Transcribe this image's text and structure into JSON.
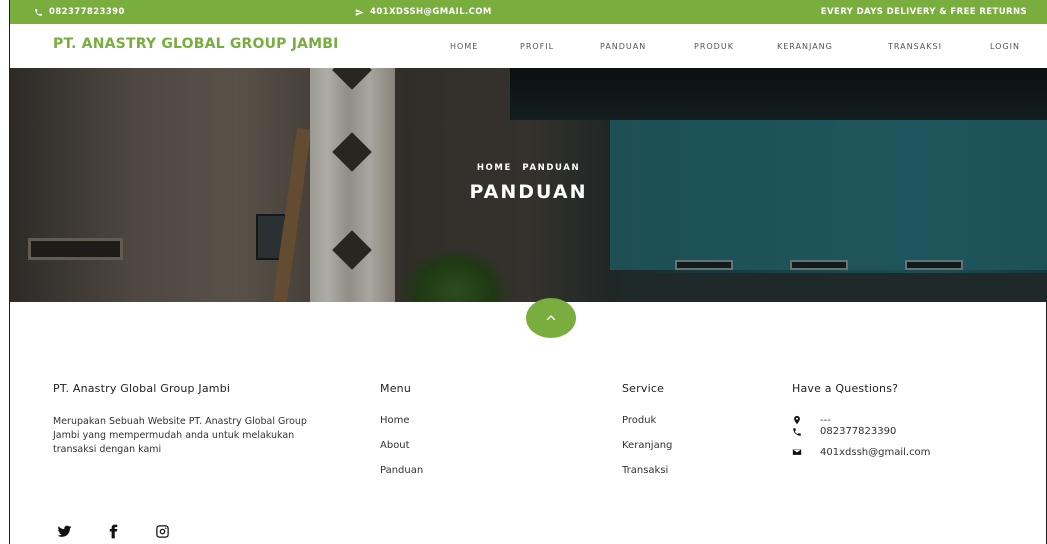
{
  "topbar": {
    "phone": "082377823390",
    "email": "401XDSSH@GMAIL.COM",
    "delivery": "EVERY DAYS DELIVERY & FREE RETURNS",
    "bg_color": "#79ad3d"
  },
  "navbar": {
    "brand": "PT. ANASTRY GLOBAL GROUP JAMBI",
    "items": [
      {
        "label": "HOME"
      },
      {
        "label": "PROFIL"
      },
      {
        "label": "PANDUAN"
      },
      {
        "label": "PRODUK"
      },
      {
        "label": "KERANJANG"
      },
      {
        "label": "TRANSAKSI"
      },
      {
        "label": "LOGIN"
      }
    ]
  },
  "hero": {
    "breadcrumb": [
      "HOME",
      "PANDUAN"
    ],
    "title": "PANDUAN"
  },
  "scroll_up": {
    "icon": "chevron-up-icon"
  },
  "footer": {
    "about": {
      "heading": "PT. Anastry Global Group Jambi",
      "text": "Merupakan Sebuah Website PT. Anastry Global Group Jambi yang mempermudah anda untuk melakukan transaksi dengan kami"
    },
    "menu": {
      "heading": "Menu",
      "items": [
        "Home",
        "About",
        "Panduan"
      ]
    },
    "service": {
      "heading": "Service",
      "items": [
        "Produk",
        "Keranjang",
        "Transaksi"
      ]
    },
    "contact": {
      "heading": "Have a Questions?",
      "address": "---",
      "phone": "082377823390",
      "email": "401xdssh@gmail.com"
    },
    "socials": [
      "twitter-icon",
      "facebook-icon",
      "instagram-icon"
    ]
  },
  "colors": {
    "accent": "#79ad3d"
  }
}
